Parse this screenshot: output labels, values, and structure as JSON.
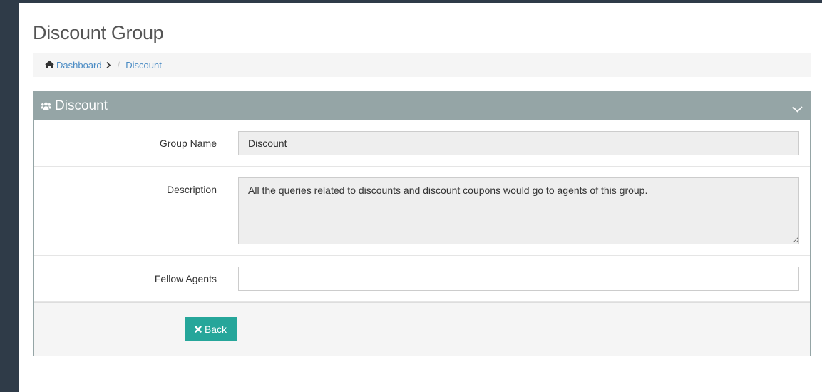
{
  "page": {
    "title": "Discount Group"
  },
  "breadcrumb": {
    "home_label": "Dashboard",
    "current_label": "Discount",
    "separator": "/"
  },
  "panel": {
    "title": "Discount",
    "header_color": "#95a5a6"
  },
  "form": {
    "group_name": {
      "label": "Group Name",
      "value": "Discount"
    },
    "description": {
      "label": "Description",
      "value": "All the queries related to discounts and discount coupons would go to agents of this group."
    },
    "fellow_agents": {
      "label": "Fellow Agents",
      "value": ""
    }
  },
  "footer": {
    "back_label": "Back",
    "back_color": "#26a69a"
  },
  "icons": {
    "breadcrumb_home": "home-icon",
    "breadcrumb_arrow": "chevron-right-icon",
    "panel": "users-icon",
    "collapse": "chevron-down-icon",
    "back": "times-icon"
  }
}
